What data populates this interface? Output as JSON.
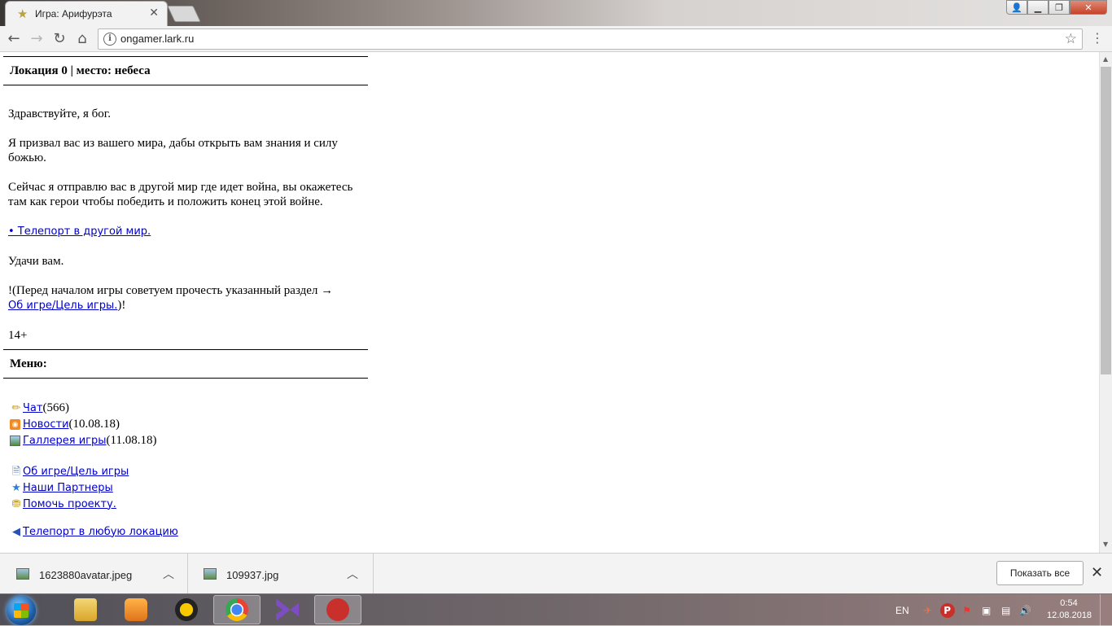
{
  "browser": {
    "tab_title": "Игра: Арифурэта",
    "url": "ongamer.lark.ru"
  },
  "page": {
    "header1": "Локация 0 | место: небеса",
    "greeting": "Здравствуйте, я бог.",
    "para1": "Я призвал вас из вашего мира, дабы открыть вам знания и силу божью.",
    "para2": "Сейчас я отправлю вас в другой мир где идет война, вы окажетесь там как герои чтобы победить и положить конец этой войне.",
    "teleport_link": "• Телепорт в другой мир.",
    "good_luck": "Удачи вам.",
    "advice_prefix": "!(Перед началом игры советуем прочесть указанный раздел →",
    "advice_link": "Об игре/Цель игры.",
    "advice_suffix": ")!",
    "age": "14+",
    "menu_header": "Меню:",
    "menu_items": [
      {
        "label": "Чат ",
        "extra": "(566)"
      },
      {
        "label": "Новости ",
        "extra": "(10.08.18)"
      },
      {
        "label": "Галлерея игры ",
        "extra": "(11.08.18)"
      }
    ],
    "menu_items2": [
      {
        "label": "Об игре/Цель игры"
      },
      {
        "label": "Наши Партнеры"
      },
      {
        "label": "Помочь проекту."
      }
    ],
    "partial_item": "Телепорт в любую локацию"
  },
  "downloads": {
    "items": [
      {
        "name": "1623880avatar.jpeg"
      },
      {
        "name": "109937.jpg"
      }
    ],
    "show_all": "Показать все"
  },
  "taskbar": {
    "lang": "EN",
    "time": "0:54",
    "date": "12.08.2018"
  }
}
